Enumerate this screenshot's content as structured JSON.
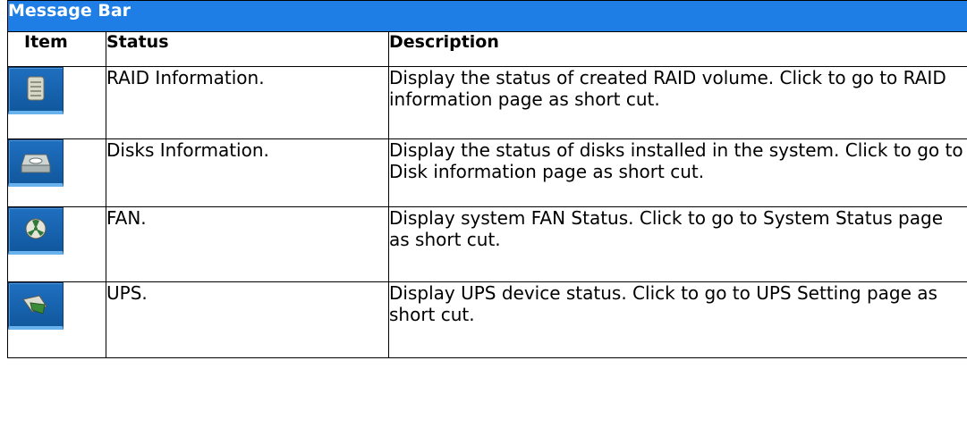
{
  "title": "Message Bar",
  "columns": {
    "item": "Item",
    "status": "Status",
    "description": "Description"
  },
  "rows": [
    {
      "icon": "raid-icon",
      "status": "RAID Information.",
      "description": "Display the status of created RAID volume. Click to go to RAID information page as short cut."
    },
    {
      "icon": "disk-icon",
      "status": "Disks Information.",
      "description": "Display the status of disks installed in the system. Click to go to Disk information page as short cut."
    },
    {
      "icon": "fan-icon",
      "status": "FAN.",
      "description": "Display system FAN Status. Click to go to System Status page as short cut."
    },
    {
      "icon": "ups-icon",
      "status": "UPS.",
      "description": "Display UPS device status. Click to go to UPS Setting page as short cut."
    }
  ],
  "colors": {
    "title_background": "#1e7ee6",
    "title_text": "#ffffff",
    "icon_background": "#11589e"
  }
}
